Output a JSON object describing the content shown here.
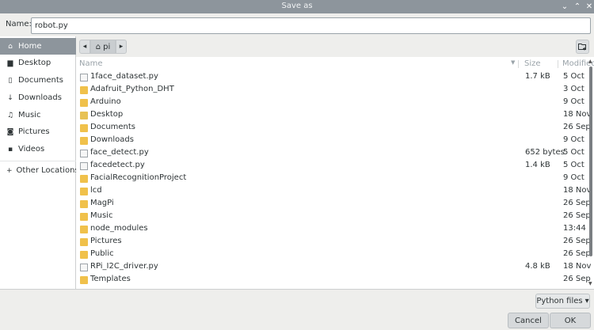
{
  "window": {
    "title": "Save as",
    "minimize_glyph": "⌄",
    "maximize_glyph": "⌃",
    "close_glyph": "✕"
  },
  "name": {
    "label": "Name:",
    "value": "robot.py"
  },
  "sidebar": {
    "items": [
      {
        "label": "Home",
        "icon": "home-icon"
      },
      {
        "label": "Desktop",
        "icon": "desktop-folder-icon"
      },
      {
        "label": "Documents",
        "icon": "document-icon"
      },
      {
        "label": "Downloads",
        "icon": "download-icon"
      },
      {
        "label": "Music",
        "icon": "music-icon"
      },
      {
        "label": "Pictures",
        "icon": "camera-icon"
      },
      {
        "label": "Videos",
        "icon": "video-icon"
      },
      {
        "label": "Other Locations",
        "icon": "plus-icon"
      }
    ]
  },
  "pathbar": {
    "current": "pi"
  },
  "columns": {
    "name": "Name",
    "size": "Size",
    "modified": "Modified"
  },
  "files": [
    {
      "name": "1face_dataset.py",
      "size": "1.7 kB",
      "modified": "5 Oct",
      "icon": "file"
    },
    {
      "name": "Adafruit_Python_DHT",
      "size": "",
      "modified": "3 Oct",
      "icon": "folder"
    },
    {
      "name": "Arduino",
      "size": "",
      "modified": "9 Oct",
      "icon": "folder"
    },
    {
      "name": "Desktop",
      "size": "",
      "modified": "18 Nov",
      "icon": "folder"
    },
    {
      "name": "Documents",
      "size": "",
      "modified": "26 Sep",
      "icon": "folder"
    },
    {
      "name": "Downloads",
      "size": "",
      "modified": "9 Oct",
      "icon": "folder"
    },
    {
      "name": "face_detect.py",
      "size": "652 bytes",
      "modified": "5 Oct",
      "icon": "file"
    },
    {
      "name": "facedetect.py",
      "size": "1.4 kB",
      "modified": "5 Oct",
      "icon": "file"
    },
    {
      "name": "FacialRecognitionProject",
      "size": "",
      "modified": "9 Oct",
      "icon": "folder"
    },
    {
      "name": "lcd",
      "size": "",
      "modified": "18 Nov",
      "icon": "folder"
    },
    {
      "name": "MagPi",
      "size": "",
      "modified": "26 Sep",
      "icon": "folder"
    },
    {
      "name": "Music",
      "size": "",
      "modified": "26 Sep",
      "icon": "folder"
    },
    {
      "name": "node_modules",
      "size": "",
      "modified": "13:44",
      "icon": "folder"
    },
    {
      "name": "Pictures",
      "size": "",
      "modified": "26 Sep",
      "icon": "folder"
    },
    {
      "name": "Public",
      "size": "",
      "modified": "26 Sep",
      "icon": "folder"
    },
    {
      "name": "RPi_I2C_driver.py",
      "size": "4.8 kB",
      "modified": "18 Nov",
      "icon": "file"
    },
    {
      "name": "Templates",
      "size": "",
      "modified": "26 Sep",
      "icon": "folder"
    }
  ],
  "footer": {
    "filter": "Python files",
    "cancel": "Cancel",
    "ok": "OK"
  },
  "colors": {
    "titlebar": "#8d959c",
    "selected": "#8d959c",
    "folder": "#f0c14b"
  }
}
